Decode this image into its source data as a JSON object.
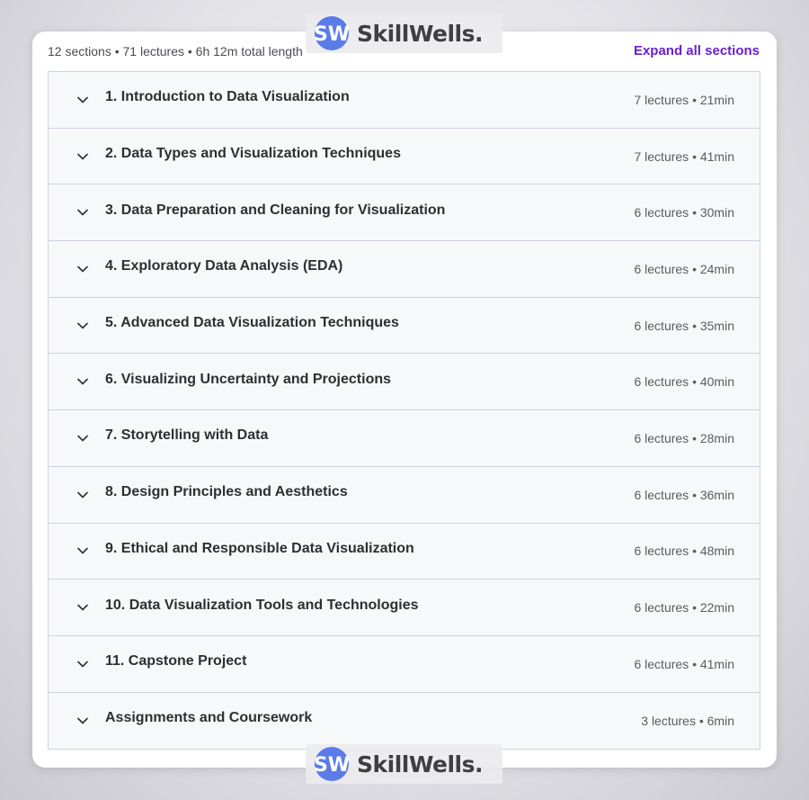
{
  "header": {
    "summary": "12 sections • 71 lectures • 6h 12m total length",
    "expand_all_label": "Expand all sections"
  },
  "sections": [
    {
      "title": "1. Introduction to Data Visualization",
      "meta": "7 lectures • 21min"
    },
    {
      "title": "2. Data Types and Visualization Techniques",
      "meta": "7 lectures • 41min"
    },
    {
      "title": "3. Data Preparation and Cleaning for Visualization",
      "meta": "6 lectures • 30min"
    },
    {
      "title": "4. Exploratory Data Analysis (EDA)",
      "meta": "6 lectures • 24min"
    },
    {
      "title": "5. Advanced Data Visualization Techniques",
      "meta": "6 lectures • 35min"
    },
    {
      "title": "6. Visualizing Uncertainty and Projections",
      "meta": "6 lectures • 40min"
    },
    {
      "title": "7. Storytelling with Data",
      "meta": "6 lectures • 28min"
    },
    {
      "title": "8. Design Principles and Aesthetics",
      "meta": "6 lectures • 36min"
    },
    {
      "title": "9. Ethical and Responsible Data Visualization",
      "meta": "6 lectures • 48min"
    },
    {
      "title": "10. Data Visualization Tools and Technologies",
      "meta": "6 lectures • 22min"
    },
    {
      "title": "11. Capstone Project",
      "meta": "6 lectures • 41min"
    },
    {
      "title": "Assignments and Coursework",
      "meta": "3 lectures • 6min"
    }
  ],
  "watermark": {
    "logo_letters": "SW",
    "brand": "SkillWells."
  },
  "colors": {
    "accent": "#6a1fd0",
    "logo_blue": "#5b7be8"
  },
  "icons": {
    "section_toggle": "chevron-down-icon"
  }
}
